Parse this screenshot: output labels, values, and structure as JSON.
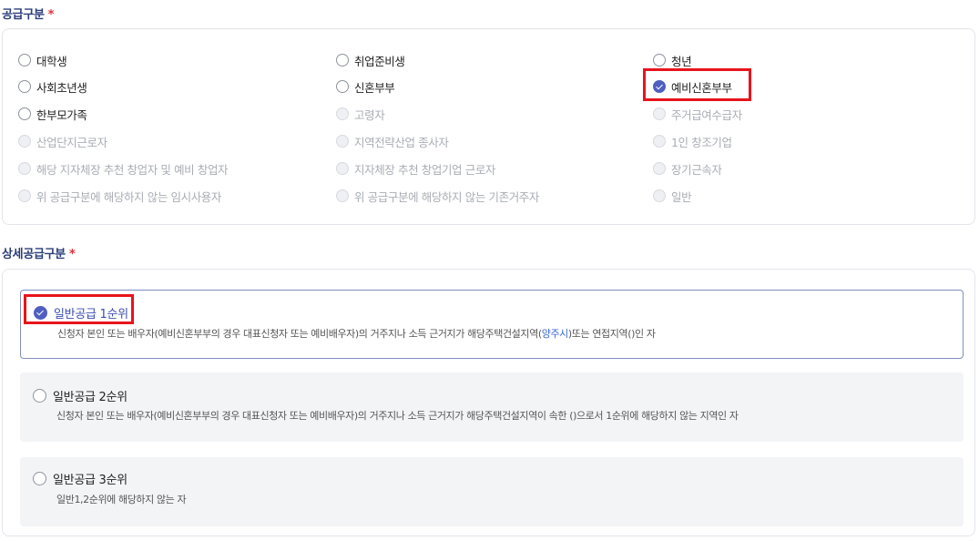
{
  "supply": {
    "title": "공급구분",
    "required_mark": "*",
    "options": [
      {
        "label": "대학생",
        "state": "enabled"
      },
      {
        "label": "취업준비생",
        "state": "enabled"
      },
      {
        "label": "청년",
        "state": "enabled"
      },
      {
        "label": "사회초년생",
        "state": "enabled"
      },
      {
        "label": "신혼부부",
        "state": "enabled"
      },
      {
        "label": "예비신혼부부",
        "state": "checked"
      },
      {
        "label": "한부모가족",
        "state": "enabled"
      },
      {
        "label": "고령자",
        "state": "disabled"
      },
      {
        "label": "주거급여수급자",
        "state": "disabled"
      },
      {
        "label": "산업단지근로자",
        "state": "disabled"
      },
      {
        "label": "지역전략산업 종사자",
        "state": "disabled"
      },
      {
        "label": "1인 창조기업",
        "state": "disabled"
      },
      {
        "label": "해당 지자체장 추천 창업자 및 예비 창업자",
        "state": "disabled"
      },
      {
        "label": "지자체장 추천 창업기업 근로자",
        "state": "disabled"
      },
      {
        "label": "장기근속자",
        "state": "disabled"
      },
      {
        "label": "위 공급구분에 해당하지 않는 임시사용자",
        "state": "disabled"
      },
      {
        "label": "위 공급구분에 해당하지 않는 기존거주자",
        "state": "disabled"
      },
      {
        "label": "일반",
        "state": "disabled"
      }
    ]
  },
  "detail": {
    "title": "상세공급구분",
    "required_mark": "*",
    "cards": [
      {
        "label": "일반공급 1순위",
        "selected": true,
        "desc_before": "신청자 본인 또는 배우자(예비신혼부부의 경우 대표신청자 또는 예비배우자)의 거주지나 소득 근거지가 해당주택건설지역(",
        "desc_link": "양주시",
        "desc_after": ")또는 연접지역()인 자"
      },
      {
        "label": "일반공급 2순위",
        "selected": false,
        "desc": "신청자 본인 또는 배우자(예비신혼부부의 경우 대표신청자 또는 예비배우자)의 거주지나 소득 근거지가 해당주택건설지역이 속한 ()으로서 1순위에 해당하지 않는 지역인 자"
      },
      {
        "label": "일반공급 3순위",
        "selected": false,
        "desc": "일반1,2순위에 해당하지 않는 자"
      }
    ]
  },
  "colors": {
    "accent": "#4f5fc0",
    "title": "#2b3e7a",
    "highlight": "#e8141c",
    "required": "#e0303a"
  }
}
